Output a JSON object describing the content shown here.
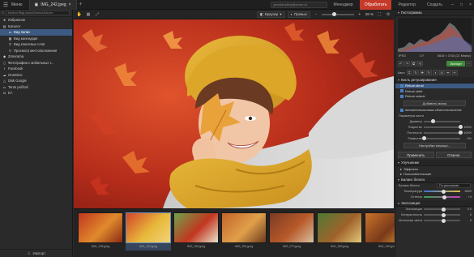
{
  "topbar": {
    "menu_label": "Меню",
    "doc_tab": "IMG_242.jpeg",
    "search_placeholder": "jaroslav.pilny@zoner.cz",
    "modes": [
      "Менеджер",
      "Обработать",
      "Редактор",
      "Создать"
    ],
    "active_mode_index": 1
  },
  "left": {
    "path": "Каталог\\Вид папки\\Осень\\Autumn",
    "items": [
      {
        "label": "Избранное",
        "icon": "star-icon",
        "sub": false,
        "sel": false
      },
      {
        "label": "Каталог",
        "icon": "catalog-icon",
        "sub": false,
        "sel": false
      },
      {
        "label": "Вид папки",
        "icon": "folder-icon",
        "sub": true,
        "sel": true
      },
      {
        "label": "Вид календаря",
        "icon": "calendar-icon",
        "sub": true,
        "sel": false
      },
      {
        "label": "Вид ключевых слов",
        "icon": "tag-icon",
        "sub": true,
        "sel": false
      },
      {
        "label": "Просмотр местоположения",
        "icon": "pin-icon",
        "sub": true,
        "sel": false
      },
      {
        "label": "Zonerama",
        "icon": "zonerama-icon",
        "sub": false,
        "sel": false
      },
      {
        "label": "Фотографии с мобильных т...",
        "icon": "phone-icon",
        "sub": false,
        "sel": false
      },
      {
        "label": "Facebook",
        "icon": "facebook-icon",
        "sub": false,
        "sel": false
      },
      {
        "label": "OneDrive",
        "icon": "cloud-icon",
        "sub": false,
        "sel": false
      },
      {
        "label": "Disk Google",
        "icon": "drive-icon",
        "sub": false,
        "sel": false
      },
      {
        "label": "Tento počítač",
        "icon": "computer-icon",
        "sub": false,
        "sel": false
      },
      {
        "label": "D:\\",
        "icon": "disk-icon",
        "sub": false,
        "sel": false
      }
    ],
    "footer": "Импорт"
  },
  "imgbar": {
    "view_mode": "Браузер",
    "preview": "Превью",
    "zoom": "28 %",
    "zoom_level": 0.4
  },
  "filmstrip": [
    {
      "name": "IMG_196.jpeg",
      "sel": false,
      "colors": [
        "#c2361f",
        "#e08a2c",
        "#8a2a18"
      ]
    },
    {
      "name": "IMG_242.jpeg",
      "sel": true,
      "colors": [
        "#d0442a",
        "#e8b83a",
        "#f2d27a"
      ]
    },
    {
      "name": "IMG_260.jpeg",
      "sel": false,
      "colors": [
        "#6fa34a",
        "#c2361f",
        "#e9e2cc"
      ]
    },
    {
      "name": "IMG_261.jpeg",
      "sel": false,
      "colors": [
        "#c4632a",
        "#e0a04a",
        "#6b3a1f"
      ]
    },
    {
      "name": "IMG_270.jpeg",
      "sel": false,
      "colors": [
        "#7a3a22",
        "#b85a2a",
        "#d8c0a0"
      ]
    },
    {
      "name": "IMG_285.jpeg",
      "sel": false,
      "colors": [
        "#4d7a34",
        "#a0622a",
        "#e0c87a"
      ]
    },
    {
      "name": "IMG_290.jpeg",
      "sel": false,
      "colors": [
        "#c9732a",
        "#7a3a1a",
        "#e8a23a"
      ]
    }
  ],
  "right": {
    "histogram_title": "Гистограмма",
    "exif_left": "IPSO",
    "exif_mid": "1/?",
    "exif_right": "5616 × 3744 (21 Мпикс)",
    "export_btn": "Экспорт",
    "tools_label": "Авто",
    "retouch_title": "Кисть ретуширования",
    "retouch_items": [
      "Retual obruti",
      "Retual oběti",
      "Retual ustauk"
    ],
    "add_mask_btn": "Добавить маску",
    "auto_mask_label": "Автоматическая маска области вычисление",
    "brush_params": "Параметры кисти",
    "brush_sliders": [
      {
        "label": "Диаметр",
        "value": "",
        "pos": 0.25
      },
      {
        "label": "Покрытие",
        "value": "100%",
        "pos": 1.0
      },
      {
        "label": "Плотность",
        "value": "100%",
        "pos": 1.0
      },
      {
        "label": "Размытие",
        "value": "0%",
        "pos": 0.0
      }
    ],
    "settings_btn": "Настройки помощн...",
    "apply_btn": "Применить",
    "cancel_btn": "Отмена",
    "effects_title": "Улучшение",
    "effects_items": [
      "Эффекты",
      "Пользовательские"
    ],
    "wb_title": "Баланс белого",
    "wb_label": "Баланс белого",
    "wb_value": "По умолчанию",
    "temp_label": "Температура",
    "temp_value": "5600",
    "tint_label": "Оттенок",
    "tint_value": "+4",
    "exposure_title": "Экспозиция",
    "exp_label": "Экспозиция",
    "exp_value": "0.0",
    "contrast_label": "Контрастность",
    "contrast_value": "0",
    "light_label": "Источники света",
    "light_value": "0"
  }
}
